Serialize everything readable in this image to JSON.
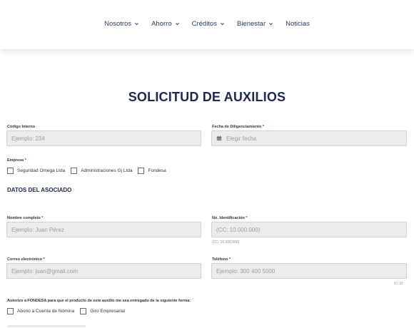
{
  "nav": {
    "items": [
      {
        "label": "Nosotros",
        "dropdown": true
      },
      {
        "label": "Ahorro",
        "dropdown": true
      },
      {
        "label": "Créditos",
        "dropdown": true
      },
      {
        "label": "Bienestar",
        "dropdown": true
      },
      {
        "label": "Noticias",
        "dropdown": false
      }
    ]
  },
  "form": {
    "title": "SOLICITUD DE AUXILIOS",
    "codigo": {
      "label": "Código Interno",
      "placeholder": "Ejemplo: 234"
    },
    "fecha": {
      "label": "Fecha de Diligenciamiento",
      "required": "*",
      "placeholder": "Elegir fecha",
      "icon": "calendar-icon"
    },
    "empresa": {
      "label": "Empresa",
      "required": "*",
      "options": [
        "Seguridad Omega Ltda",
        "Administraciones Gj Ltda",
        "Fondesa"
      ]
    },
    "section_asociado": "DATOS DEL ASOCIADO",
    "nombre": {
      "label": "Nombre completo",
      "required": "*",
      "placeholder": "Ejemplo: Juan Pérez"
    },
    "identificacion": {
      "label": "No. Identificación",
      "required": "*",
      "placeholder": "(CC: 10.000.000)",
      "hint": "(CC: 10.000.000)"
    },
    "correo": {
      "label": "Correo electrónico",
      "required": "*",
      "placeholder": "Ejemplo: juan@gmail.com"
    },
    "telefono": {
      "label": "Teléfono",
      "required": "*",
      "placeholder": "Ejemplo: 300 400 5000",
      "counter": "0 / 10"
    },
    "autorizo": {
      "label": "Autorizo a FONDESA para que el producto de este auxilio me sea entregado de la siguiente forma:",
      "options": [
        "Abono a Cuenta de Nómina",
        "Giro Empresarial"
      ]
    }
  },
  "colors": {
    "accent": "#1b2850",
    "required": "#d0021b",
    "input_bg": "#ececec"
  }
}
